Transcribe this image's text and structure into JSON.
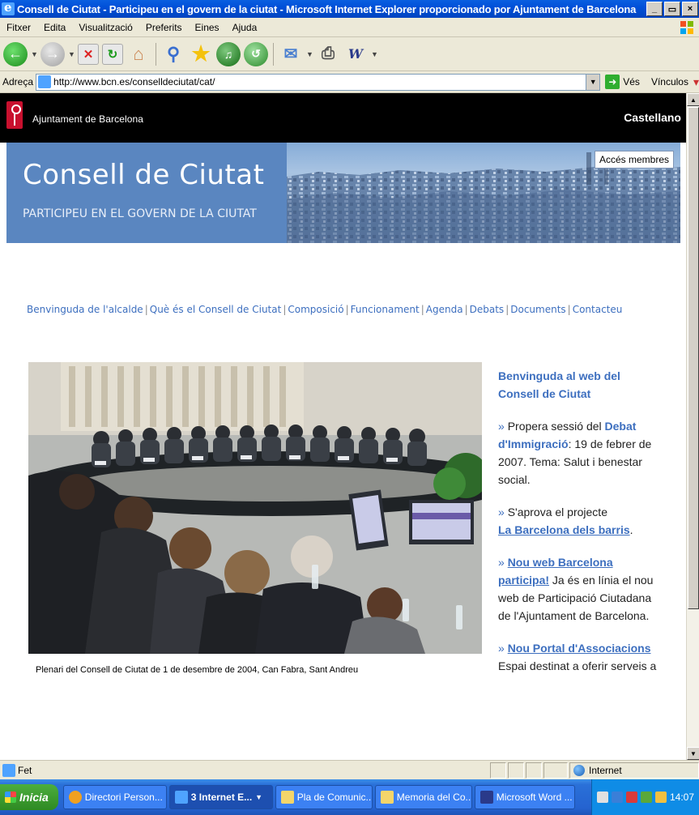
{
  "window": {
    "title": "Consell de Ciutat - Participeu en el govern de la ciutat - Microsoft Internet Explorer proporcionado por Ajuntament de Barcelona",
    "min_label": "_",
    "max_label": "▭",
    "close_label": "×"
  },
  "menu": {
    "items": [
      "Fitxer",
      "Edita",
      "Visualització",
      "Preferits",
      "Eines",
      "Ajuda"
    ]
  },
  "address": {
    "label": "Adreça",
    "url": "http://www.bcn.es/conselldeciutat/cat/",
    "go_label": "Vés",
    "links_label": "Vínculos"
  },
  "site": {
    "org_name": "Ajuntament de Barcelona",
    "lang_link": "Castellano",
    "banner_title": "Consell de Ciutat",
    "banner_subtitle": "PARTICIPEU EN EL GOVERN DE LA CIUTAT",
    "members_button": "Accés membres",
    "nav": [
      "Benvinguda de l'alcalde",
      "Què és el Consell de Ciutat",
      "Composició",
      "Funcionament",
      "Agenda",
      "Debats",
      "Documents",
      "Contacteu"
    ],
    "photo_caption": "Plenari del Consell de Ciutat de 1 de desembre de 2004, Can Fabra, Sant Andreu"
  },
  "news": {
    "lead": "Benvinguda al web del Consell de Ciutat",
    "item1_prefix": "Propera sessió del",
    "item1_link": "Debat d'Immigració",
    "item1_rest": ": 19 de febrer de 2007. Tema: Salut i benestar social.",
    "item2_prefix": "S'aprova el projecte",
    "item2_link": "La Barcelona dels barris",
    "item2_suffix": ".",
    "item3_link": "Nou web Barcelona participa!",
    "item3_rest": " Ja és en línia el nou web de Participació Ciutadana de l'Ajuntament de Barcelona.",
    "item4_link": "Nou Portal d'Associacions",
    "item4_rest": "Espai destinat a oferir serveis a"
  },
  "status": {
    "text": "Fet",
    "zone": "Internet"
  },
  "taskbar": {
    "start_label": "Inicia",
    "tasks": [
      "Directori Person...",
      "3 Internet E...",
      "Pla de Comunic...",
      "Memoria del Co...",
      "Microsoft Word ..."
    ],
    "clock": "14:07"
  },
  "colors": {
    "link_blue": "#3d6fbf",
    "banner_blue": "#5a86c0",
    "xp_title": "#0050d8"
  }
}
